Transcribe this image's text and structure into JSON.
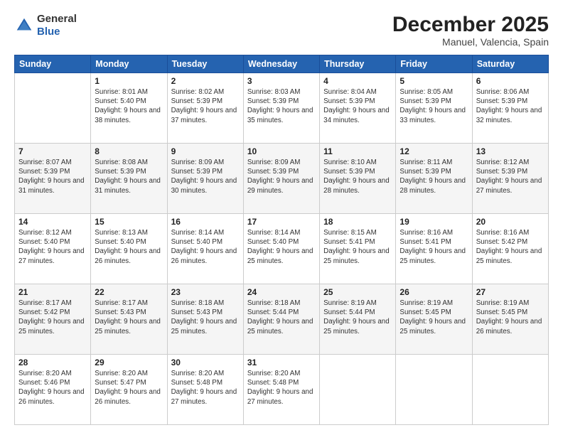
{
  "header": {
    "logo_line1": "General",
    "logo_line2": "Blue",
    "month": "December 2025",
    "location": "Manuel, Valencia, Spain"
  },
  "weekdays": [
    "Sunday",
    "Monday",
    "Tuesday",
    "Wednesday",
    "Thursday",
    "Friday",
    "Saturday"
  ],
  "weeks": [
    [
      {
        "day": "",
        "sunrise": "",
        "sunset": "",
        "daylight": ""
      },
      {
        "day": "1",
        "sunrise": "Sunrise: 8:01 AM",
        "sunset": "Sunset: 5:40 PM",
        "daylight": "Daylight: 9 hours and 38 minutes."
      },
      {
        "day": "2",
        "sunrise": "Sunrise: 8:02 AM",
        "sunset": "Sunset: 5:39 PM",
        "daylight": "Daylight: 9 hours and 37 minutes."
      },
      {
        "day": "3",
        "sunrise": "Sunrise: 8:03 AM",
        "sunset": "Sunset: 5:39 PM",
        "daylight": "Daylight: 9 hours and 35 minutes."
      },
      {
        "day": "4",
        "sunrise": "Sunrise: 8:04 AM",
        "sunset": "Sunset: 5:39 PM",
        "daylight": "Daylight: 9 hours and 34 minutes."
      },
      {
        "day": "5",
        "sunrise": "Sunrise: 8:05 AM",
        "sunset": "Sunset: 5:39 PM",
        "daylight": "Daylight: 9 hours and 33 minutes."
      },
      {
        "day": "6",
        "sunrise": "Sunrise: 8:06 AM",
        "sunset": "Sunset: 5:39 PM",
        "daylight": "Daylight: 9 hours and 32 minutes."
      }
    ],
    [
      {
        "day": "7",
        "sunrise": "Sunrise: 8:07 AM",
        "sunset": "Sunset: 5:39 PM",
        "daylight": "Daylight: 9 hours and 31 minutes."
      },
      {
        "day": "8",
        "sunrise": "Sunrise: 8:08 AM",
        "sunset": "Sunset: 5:39 PM",
        "daylight": "Daylight: 9 hours and 31 minutes."
      },
      {
        "day": "9",
        "sunrise": "Sunrise: 8:09 AM",
        "sunset": "Sunset: 5:39 PM",
        "daylight": "Daylight: 9 hours and 30 minutes."
      },
      {
        "day": "10",
        "sunrise": "Sunrise: 8:09 AM",
        "sunset": "Sunset: 5:39 PM",
        "daylight": "Daylight: 9 hours and 29 minutes."
      },
      {
        "day": "11",
        "sunrise": "Sunrise: 8:10 AM",
        "sunset": "Sunset: 5:39 PM",
        "daylight": "Daylight: 9 hours and 28 minutes."
      },
      {
        "day": "12",
        "sunrise": "Sunrise: 8:11 AM",
        "sunset": "Sunset: 5:39 PM",
        "daylight": "Daylight: 9 hours and 28 minutes."
      },
      {
        "day": "13",
        "sunrise": "Sunrise: 8:12 AM",
        "sunset": "Sunset: 5:39 PM",
        "daylight": "Daylight: 9 hours and 27 minutes."
      }
    ],
    [
      {
        "day": "14",
        "sunrise": "Sunrise: 8:12 AM",
        "sunset": "Sunset: 5:40 PM",
        "daylight": "Daylight: 9 hours and 27 minutes."
      },
      {
        "day": "15",
        "sunrise": "Sunrise: 8:13 AM",
        "sunset": "Sunset: 5:40 PM",
        "daylight": "Daylight: 9 hours and 26 minutes."
      },
      {
        "day": "16",
        "sunrise": "Sunrise: 8:14 AM",
        "sunset": "Sunset: 5:40 PM",
        "daylight": "Daylight: 9 hours and 26 minutes."
      },
      {
        "day": "17",
        "sunrise": "Sunrise: 8:14 AM",
        "sunset": "Sunset: 5:40 PM",
        "daylight": "Daylight: 9 hours and 25 minutes."
      },
      {
        "day": "18",
        "sunrise": "Sunrise: 8:15 AM",
        "sunset": "Sunset: 5:41 PM",
        "daylight": "Daylight: 9 hours and 25 minutes."
      },
      {
        "day": "19",
        "sunrise": "Sunrise: 8:16 AM",
        "sunset": "Sunset: 5:41 PM",
        "daylight": "Daylight: 9 hours and 25 minutes."
      },
      {
        "day": "20",
        "sunrise": "Sunrise: 8:16 AM",
        "sunset": "Sunset: 5:42 PM",
        "daylight": "Daylight: 9 hours and 25 minutes."
      }
    ],
    [
      {
        "day": "21",
        "sunrise": "Sunrise: 8:17 AM",
        "sunset": "Sunset: 5:42 PM",
        "daylight": "Daylight: 9 hours and 25 minutes."
      },
      {
        "day": "22",
        "sunrise": "Sunrise: 8:17 AM",
        "sunset": "Sunset: 5:43 PM",
        "daylight": "Daylight: 9 hours and 25 minutes."
      },
      {
        "day": "23",
        "sunrise": "Sunrise: 8:18 AM",
        "sunset": "Sunset: 5:43 PM",
        "daylight": "Daylight: 9 hours and 25 minutes."
      },
      {
        "day": "24",
        "sunrise": "Sunrise: 8:18 AM",
        "sunset": "Sunset: 5:44 PM",
        "daylight": "Daylight: 9 hours and 25 minutes."
      },
      {
        "day": "25",
        "sunrise": "Sunrise: 8:19 AM",
        "sunset": "Sunset: 5:44 PM",
        "daylight": "Daylight: 9 hours and 25 minutes."
      },
      {
        "day": "26",
        "sunrise": "Sunrise: 8:19 AM",
        "sunset": "Sunset: 5:45 PM",
        "daylight": "Daylight: 9 hours and 25 minutes."
      },
      {
        "day": "27",
        "sunrise": "Sunrise: 8:19 AM",
        "sunset": "Sunset: 5:45 PM",
        "daylight": "Daylight: 9 hours and 26 minutes."
      }
    ],
    [
      {
        "day": "28",
        "sunrise": "Sunrise: 8:20 AM",
        "sunset": "Sunset: 5:46 PM",
        "daylight": "Daylight: 9 hours and 26 minutes."
      },
      {
        "day": "29",
        "sunrise": "Sunrise: 8:20 AM",
        "sunset": "Sunset: 5:47 PM",
        "daylight": "Daylight: 9 hours and 26 minutes."
      },
      {
        "day": "30",
        "sunrise": "Sunrise: 8:20 AM",
        "sunset": "Sunset: 5:48 PM",
        "daylight": "Daylight: 9 hours and 27 minutes."
      },
      {
        "day": "31",
        "sunrise": "Sunrise: 8:20 AM",
        "sunset": "Sunset: 5:48 PM",
        "daylight": "Daylight: 9 hours and 27 minutes."
      },
      {
        "day": "",
        "sunrise": "",
        "sunset": "",
        "daylight": ""
      },
      {
        "day": "",
        "sunrise": "",
        "sunset": "",
        "daylight": ""
      },
      {
        "day": "",
        "sunrise": "",
        "sunset": "",
        "daylight": ""
      }
    ]
  ]
}
